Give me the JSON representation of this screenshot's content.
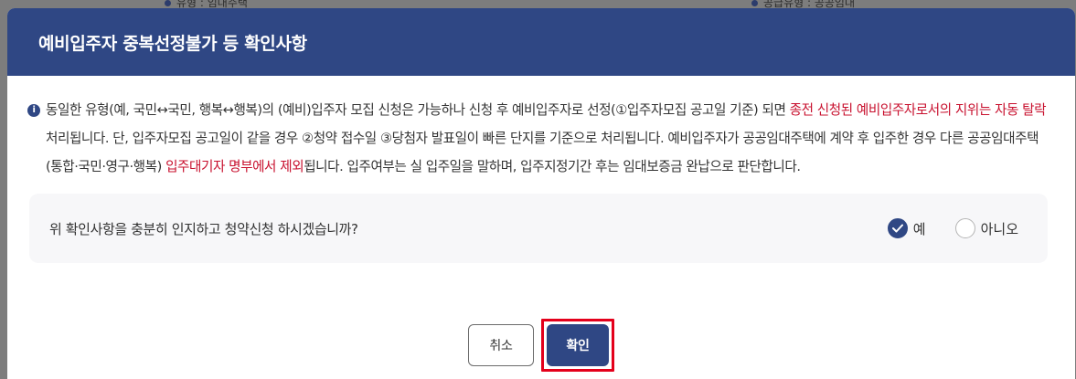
{
  "background": {
    "left_text": "유형 : 임대주택",
    "right_text": "공급유형 : 공공임대"
  },
  "dialog": {
    "title": "예비입주자 중복선정불가 등 확인사항",
    "info_icon_glyph": "i",
    "notice": {
      "part1": "동일한 유형(예, 국민↔국민, 행복↔행복)의 (예비)입주자 모집 신청은 가능하나 신청 후 예비입주자로 선정(①입주자모집 공고일 기준) 되면 ",
      "highlight1": "종전 신청된 예비입주자로서의 지위는 자동 탈락",
      "part2": " 처리됩니다. 단, 입주자모집 공고일이 같을 경우 ②청약 접수일 ③당첨자 발표일이 빠른 단지를 기준으로 처리됩니다. 예비입주자가 공공임대주택에 계약 후 입주한 경우 다른 공공임대주택(통합·국민·영구·행복) ",
      "highlight2": "입주대기자 명부에서 제외",
      "part3": "됩니다. 입주여부는 실 입주일을 말하며, 입주지정기간 후는 임대보증금 완납으로 판단합니다."
    },
    "confirm": {
      "question": "위 확인사항을 충분히 인지하고 청약신청 하시겠습니까?",
      "options": [
        {
          "label": "예",
          "checked": true
        },
        {
          "label": "아니오",
          "checked": false
        }
      ]
    },
    "buttons": {
      "cancel_label": "취소",
      "ok_label": "확인"
    }
  },
  "colors": {
    "primary": "#2f4784",
    "highlight": "#c8102e",
    "annotation_border": "#e4001b"
  }
}
